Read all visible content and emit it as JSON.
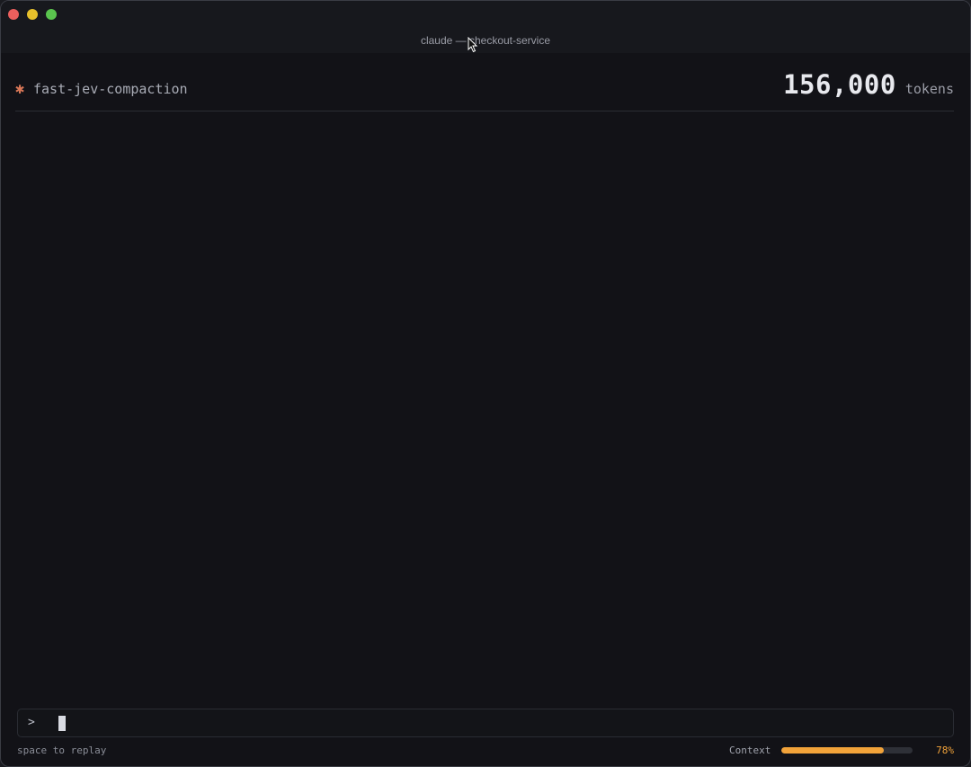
{
  "window": {
    "title": "claude — checkout-service"
  },
  "session": {
    "star_icon": "asterisk-icon",
    "name": "fast-jev-compaction",
    "token_count": "156,000",
    "token_unit": "tokens"
  },
  "prompt": {
    "symbol": ">",
    "value": ""
  },
  "footer": {
    "hint": "space to replay",
    "context_label": "Context",
    "context_percent_text": "78%",
    "context_fraction": 0.78
  },
  "colors": {
    "accent_orange": "#f2a33a",
    "star_orange": "#d97757",
    "background": "#121217"
  }
}
